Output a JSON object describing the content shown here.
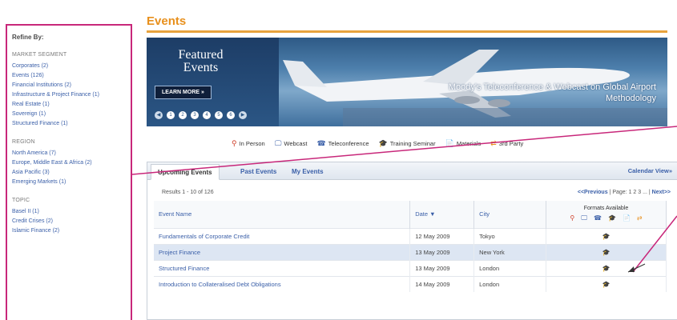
{
  "sidebar": {
    "heading": "Refine By:",
    "sections": [
      {
        "title": "MARKET SEGMENT",
        "items": [
          "Corporates (2)",
          "Events (126)",
          "Financial Institutions (2)",
          "Infrastructure & Project Finance (1)",
          "Real Estate (1)",
          "Sovereign (1)",
          "Structured Finance (1)"
        ]
      },
      {
        "title": "REGION",
        "items": [
          "North America (7)",
          "Europe, Middle East & Africa (2)",
          "Asia Pacific (3)",
          "Emerging Markets (1)"
        ]
      },
      {
        "title": "TOPIC",
        "items": [
          "Basel II (1)",
          "Credit Crises (2)",
          "Islamic Finance (2)"
        ]
      }
    ]
  },
  "page_title": "Events",
  "banner": {
    "featured_title": "Featured Events",
    "learn_more": "LEARN MORE »",
    "dots": [
      "1",
      "2",
      "3",
      "4",
      "5",
      "6"
    ],
    "caption": "Moody's Teleconference & Webcast on Global Airport Methodology"
  },
  "legend": [
    {
      "icon": "person-icon",
      "glyph": "⚲",
      "label": "In Person"
    },
    {
      "icon": "webcast-icon",
      "glyph": "🖵",
      "label": "Webcast"
    },
    {
      "icon": "telephone-icon",
      "glyph": "☎",
      "label": "Teleconference"
    },
    {
      "icon": "training-icon",
      "glyph": "🎓",
      "label": "Training Seminar"
    },
    {
      "icon": "materials-icon",
      "glyph": "📄",
      "label": "Materials"
    },
    {
      "icon": "third-party-icon",
      "glyph": "⇄",
      "label": "3rd Party"
    }
  ],
  "tabs": [
    "Upcoming Events",
    "Past Events",
    "My Events"
  ],
  "calendar_view": "Calendar View»",
  "results_text": "Results 1 - 10 of 126",
  "pager": {
    "previous": "<<Previous",
    "page_label": "| Page: 1 2 3 ... |",
    "next": "Next>>"
  },
  "table": {
    "headers": {
      "name": "Event Name",
      "date": "Date ▼",
      "city": "City",
      "formats": "Formats Available"
    },
    "rows": [
      {
        "name": "Fundamentals of Corporate Credit",
        "date": "12 May 2009",
        "city": "Tokyo",
        "format": "🎓"
      },
      {
        "name": "Project Finance",
        "date": "13 May 2009",
        "city": "New York",
        "format": "🎓"
      },
      {
        "name": "Structured Finance",
        "date": "13 May 2009",
        "city": "London",
        "format": "🎓"
      },
      {
        "name": "Introduction to Collateralised Debt Obligations",
        "date": "14 May 2009",
        "city": "London",
        "format": "🎓"
      }
    ]
  },
  "colors": {
    "accent": "#e8901d",
    "link": "#3a5fa8",
    "highlight_box": "#c8277a",
    "row_highlight": "#dde6f3"
  }
}
